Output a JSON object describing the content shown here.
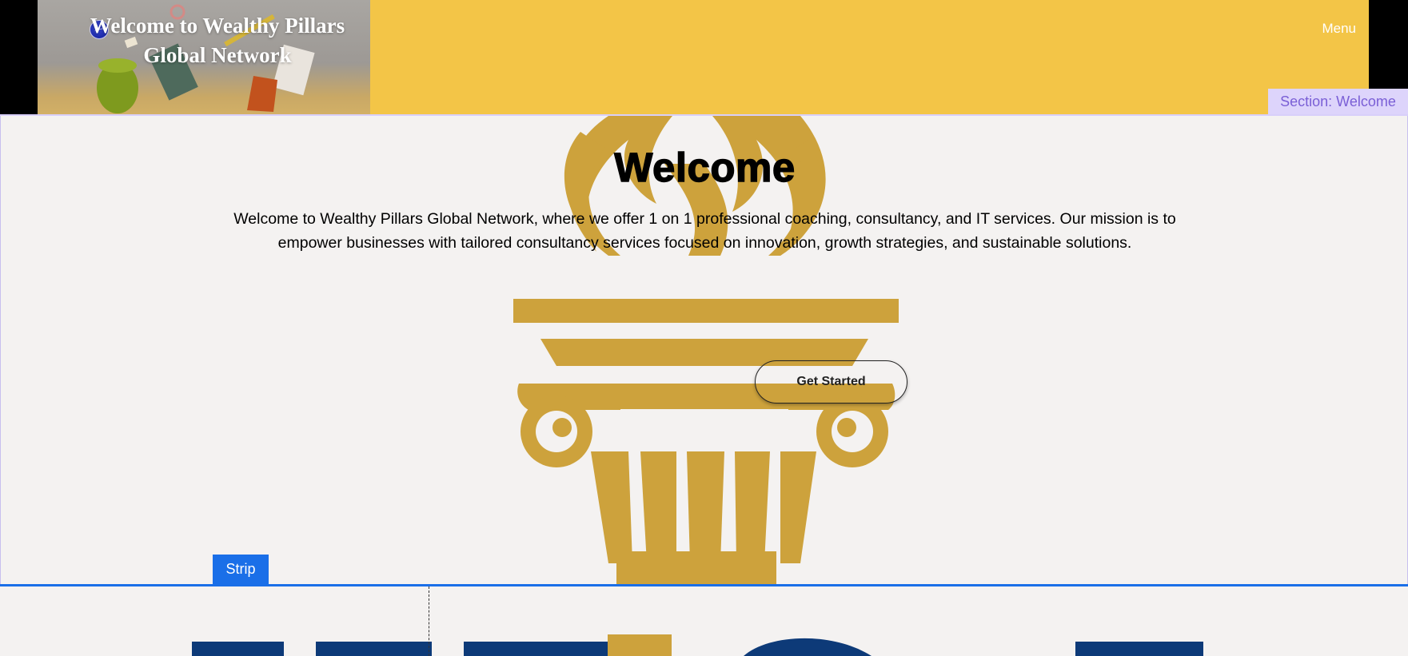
{
  "header": {
    "hero_title": "Welcome to Wealthy Pillars Global Network",
    "menu_label": "Menu",
    "bar_color": "#f3c547"
  },
  "editor": {
    "section_label": "Section: Welcome",
    "strip_label": "Strip",
    "section_color": "#ddd4fb",
    "strip_color": "#1a6fe8"
  },
  "welcome": {
    "title": "Welcome",
    "body": "Welcome to Wealthy Pillars Global Network, where we offer 1 on 1 professional coaching, consultancy, and IT services. Our mission is to empower businesses with tailored consultancy services focused on innovation, growth strategies, and sustainable solutions.",
    "cta_label": "Get Started"
  },
  "colors": {
    "gold": "#cda23c",
    "navy": "#0d3a78",
    "background": "#f4f2f1"
  },
  "icons": {
    "logo": "globe-logo-icon",
    "emblem": "torch-pillar-emblem"
  }
}
